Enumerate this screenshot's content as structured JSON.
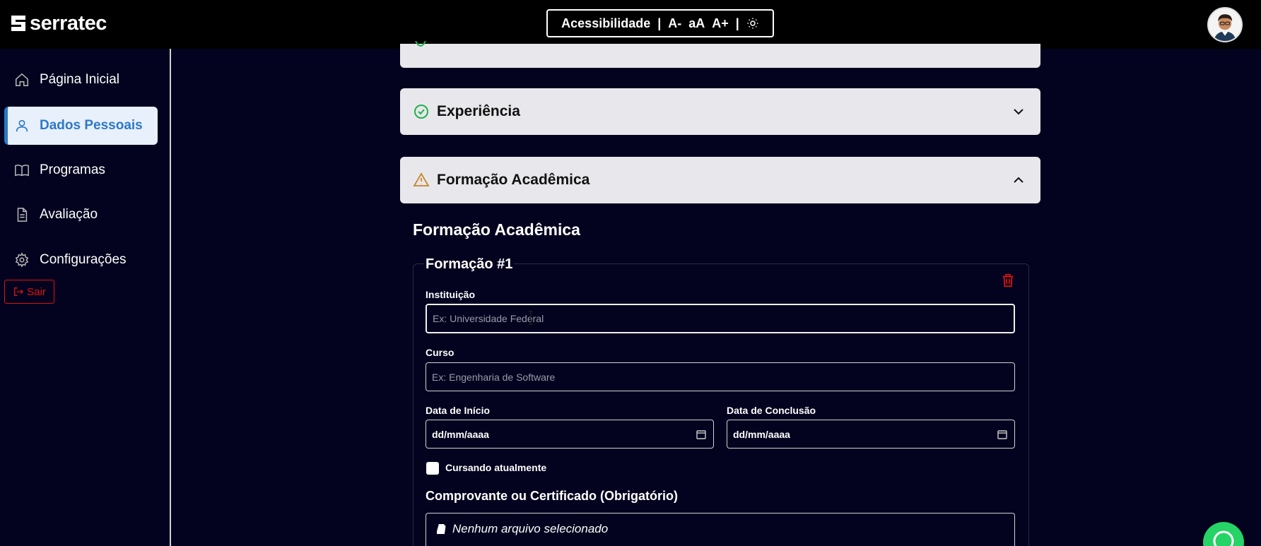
{
  "header": {
    "logo_text": "serratec",
    "accessibility": {
      "label": "Acessibilidade",
      "separator": "|",
      "decrease": "A-",
      "reset": "aA",
      "increase": "A+",
      "theme_icon": "sun-icon"
    },
    "avatar_icon": "user-avatar"
  },
  "sidebar": {
    "items": [
      {
        "label": "Página Inicial",
        "icon": "home-icon",
        "active": false
      },
      {
        "label": "Dados Pessoais",
        "icon": "user-icon",
        "active": true
      },
      {
        "label": "Programas",
        "icon": "book-icon",
        "active": false
      },
      {
        "label": "Avaliação",
        "icon": "document-icon",
        "active": false
      },
      {
        "label": "Configurações",
        "icon": "gear-icon",
        "active": false
      }
    ],
    "logout_label": "Sair"
  },
  "accordions": {
    "experience": {
      "title": "Experiência",
      "status": "complete",
      "expanded": false
    },
    "education": {
      "title": "Formação Acadêmica",
      "status": "warning",
      "expanded": true
    }
  },
  "form": {
    "section_title": "Formação Acadêmica",
    "entry_title": "Formação #1",
    "institution": {
      "label": "Instituição",
      "placeholder": "Ex: Universidade Federal",
      "value": ""
    },
    "course": {
      "label": "Curso",
      "placeholder": "Ex: Engenharia de Software",
      "value": ""
    },
    "start_date": {
      "label": "Data de Início",
      "value": "dd/mm/aaaa"
    },
    "end_date": {
      "label": "Data de Conclusão",
      "value": "dd/mm/aaaa"
    },
    "currently_studying": {
      "label": "Cursando atualmente",
      "checked": false
    },
    "certificate": {
      "title": "Comprovante ou Certificado (Obrigatório)",
      "file_status": "Nenhum arquivo selecionado"
    }
  },
  "colors": {
    "background": "#03031f",
    "accent": "#2d79c7",
    "success": "#22b14c",
    "warning": "#c8842a",
    "danger": "#dd1111",
    "whatsapp": "#25d366"
  }
}
